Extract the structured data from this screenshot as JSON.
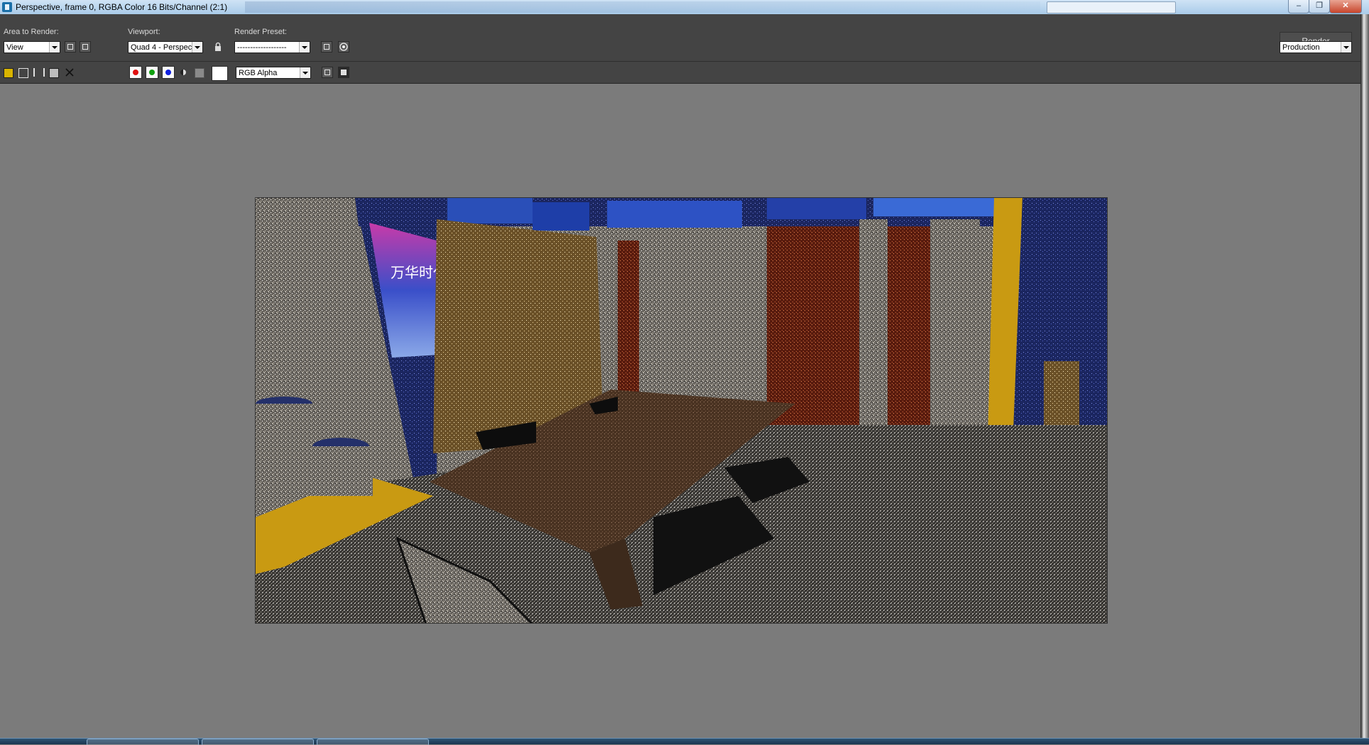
{
  "window": {
    "title": "Perspective, frame 0, RGBA Color 16 Bits/Channel (2:1)",
    "minimize": "–",
    "maximize": "❐",
    "close": "✕"
  },
  "panel": {
    "area_label": "Area to Render:",
    "area_value": "View",
    "viewport_label": "Viewport:",
    "viewport_value": "Quad 4 - Perspec",
    "preset_label": "Render Preset:",
    "preset_value": "-------------------",
    "render_button": "Render",
    "production_value": "Production"
  },
  "toolbar": {
    "channel_value": "RGB Alpha",
    "colors": {
      "red": "#e01010",
      "green": "#10a010",
      "blue": "#1020e0"
    }
  },
  "render": {
    "poster_title": "万华时代"
  }
}
